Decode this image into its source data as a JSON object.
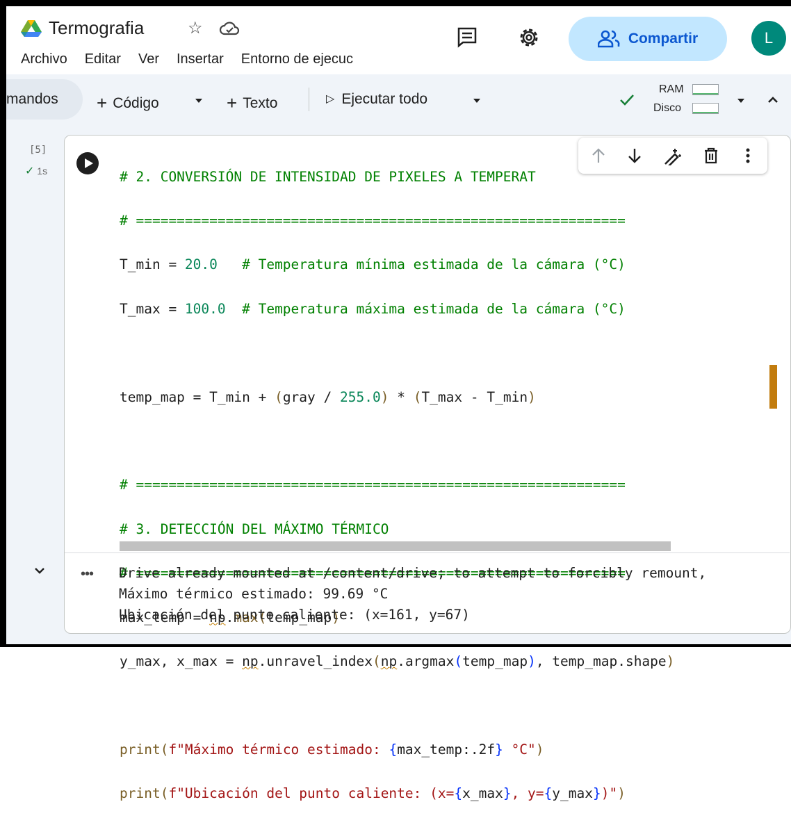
{
  "header": {
    "title": "Termografia",
    "menu": [
      "Archivo",
      "Editar",
      "Ver",
      "Insertar",
      "Entorno de ejecuc"
    ],
    "share_label": "Compartir",
    "avatar_initial": "L",
    "icons": [
      "drive-logo-icon",
      "star-icon",
      "cloud-sync-icon",
      "comments-icon",
      "settings-gear-icon",
      "share-people-icon"
    ]
  },
  "toolbar": {
    "commands_label": "mandos",
    "add_code": "Código",
    "add_text": "Texto",
    "run_all": "Ejecutar todo",
    "ram_label": "RAM",
    "disk_label": "Disco",
    "status": "connected"
  },
  "cell": {
    "exec_count": "[5]",
    "exec_time": "1s",
    "code": {
      "l1": "# 2. CONVERSIÓN DE INTENSIDAD DE PIXELES A TEMPERAT",
      "l2": "# ============================================================",
      "l3a": "T_min = ",
      "l3num": "20.0",
      "l3cm": "   # Temperatura mínima estimada de la cámara (°C)",
      "l4a": "T_max = ",
      "l4num": "100.0",
      "l4cm": "  # Temperatura máxima estimada de la cámara (°C)",
      "l6a": "temp_map = T_min + ",
      "l6b": "(",
      "l6c": "gray / ",
      "l6num": "255.0",
      "l6d": ")",
      "l6e": " * ",
      "l6f": "(",
      "l6g": "T_max - T_min",
      "l6h": ")",
      "l8": "# ============================================================",
      "l9": "# 3. DETECCIÓN DEL MÁXIMO TÉRMICO",
      "l10": "# ============================================================",
      "l11a": "max_temp = ",
      "l11np": "np",
      "l11b": ".",
      "l11fn": "max",
      "l11c": "(",
      "l11d": "temp_map",
      "l11e": ")",
      "l12a": "y_max, x_max = ",
      "l12np": "np",
      "l12b": ".unravel_index",
      "l12c": "(",
      "l12np2": "np",
      "l12d": ".argmax",
      "l12e": "(",
      "l12f": "temp_map",
      "l12g": ")",
      "l12h": ", temp_map.shape",
      "l12i": ")",
      "l14fn": "print",
      "l14a": "(",
      "l14str1": "f\"Máximo térmico estimado: ",
      "l14b": "{",
      "l14c": "max_temp:.2f",
      "l14d": "}",
      "l14str2": " °C\"",
      "l14e": ")",
      "l15fn": "print",
      "l15a": "(",
      "l15str1": "f\"Ubicación del punto caliente: (x=",
      "l15b": "{",
      "l15c": "x_max",
      "l15d": "}",
      "l15str2": ", y=",
      "l15e": "{",
      "l15f": "y_max",
      "l15g": "}",
      "l15str3": ")\"",
      "l15h": ")"
    },
    "output": [
      "Drive already mounted at /content/drive; to attempt to forcibly remount,",
      "Máximo térmico estimado: 99.69 °C",
      "Ubicación del punto caliente: (x=161, y=67)"
    ],
    "output_dots": "•••",
    "toolbar_icons": [
      "move-up-icon",
      "move-down-icon",
      "edit-magic-icon",
      "delete-icon",
      "more-vert-icon"
    ]
  },
  "colors": {
    "comment": "#008000",
    "number": "#098658",
    "function": "#795e26",
    "string": "#a31515",
    "bracket": "#0431fa",
    "accent": "#0b57d0",
    "share_bg": "#c2e7ff",
    "avatar_bg": "#00897b",
    "modified_marker": "#c27c0e"
  }
}
